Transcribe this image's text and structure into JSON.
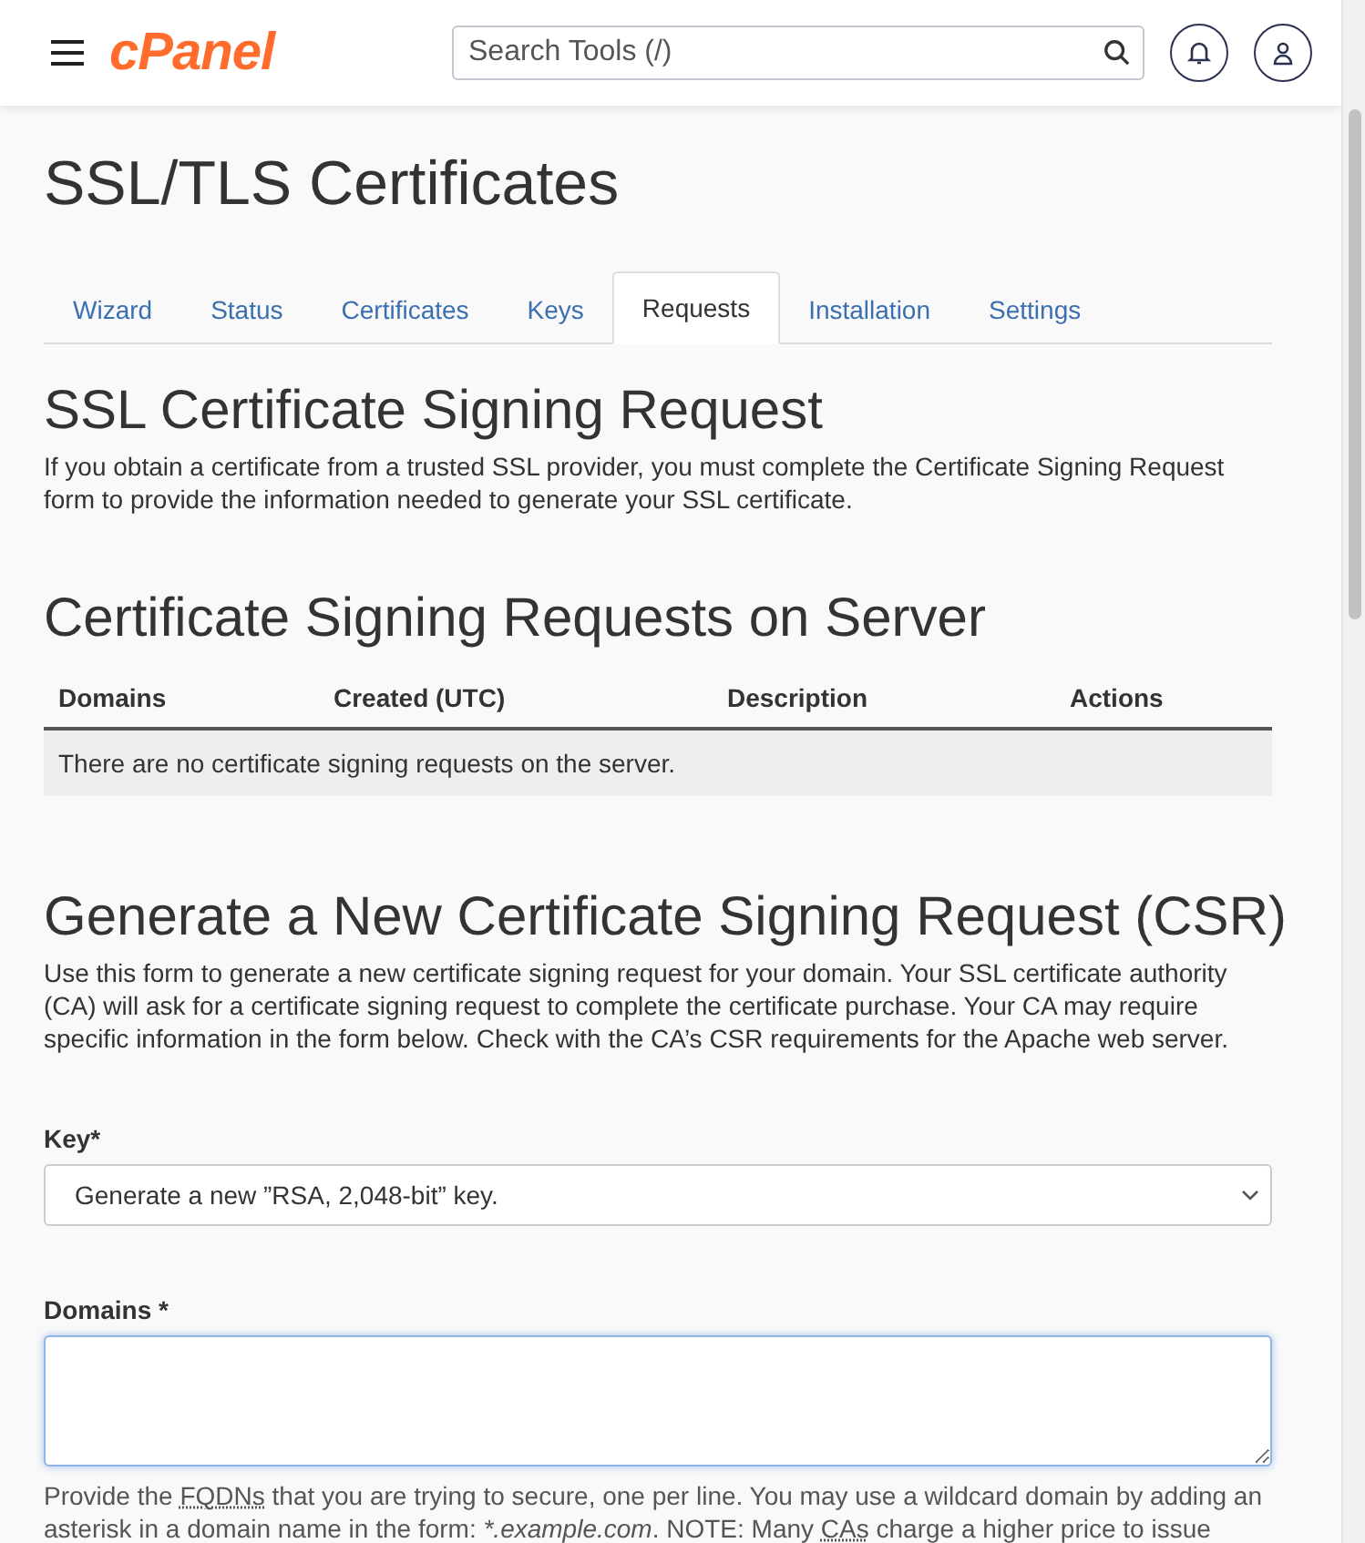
{
  "header": {
    "logo": "cPanel",
    "search": {
      "placeholder": "Search Tools (/)"
    }
  },
  "page_title": "SSL/TLS Certificates",
  "tabs": [
    {
      "label": "Wizard",
      "selected": false
    },
    {
      "label": "Status",
      "selected": false
    },
    {
      "label": "Certificates",
      "selected": false
    },
    {
      "label": "Keys",
      "selected": false
    },
    {
      "label": "Requests",
      "selected": true
    },
    {
      "label": "Installation",
      "selected": false
    },
    {
      "label": "Settings",
      "selected": false
    }
  ],
  "intro": {
    "heading": "SSL Certificate Signing Request",
    "text": "If you obtain a certificate from a trusted SSL provider, you must complete the Certificate Signing Request form to provide the information needed to generate your SSL certificate."
  },
  "requests": {
    "heading": "Certificate Signing Requests on Server",
    "columns": [
      "Domains",
      "Created (UTC)",
      "Description",
      "Actions"
    ],
    "empty_message": "There are no certificate signing requests on the server."
  },
  "generate": {
    "heading": "Generate a New Certificate Signing Request (CSR)",
    "text": "Use this form to generate a new certificate signing request for your domain. Your SSL certificate authority (CA) will ask for a certificate signing request to complete the certificate purchase. Your CA may require specific information in the form below. Check with the CA’s CSR requirements for the Apache web server.",
    "key": {
      "label": "Key*",
      "value": "Generate a new ”RSA, 2,048-bit” key."
    },
    "domains": {
      "label": "Domains *",
      "focused": true,
      "help": [
        {
          "kind": "text",
          "text": "Provide the "
        },
        {
          "kind": "abbr",
          "text": "FQDNs"
        },
        {
          "kind": "text",
          "text": " that you are trying to secure, one per line. You may use a wildcard domain by adding an asterisk in a domain name in the form: "
        },
        {
          "kind": "italic",
          "text": "*.example.com"
        },
        {
          "kind": "text",
          "text": ". NOTE: Many "
        },
        {
          "kind": "abbr",
          "text": "CAs"
        },
        {
          "kind": "text",
          "text": " charge a higher price to issue"
        }
      ]
    }
  }
}
